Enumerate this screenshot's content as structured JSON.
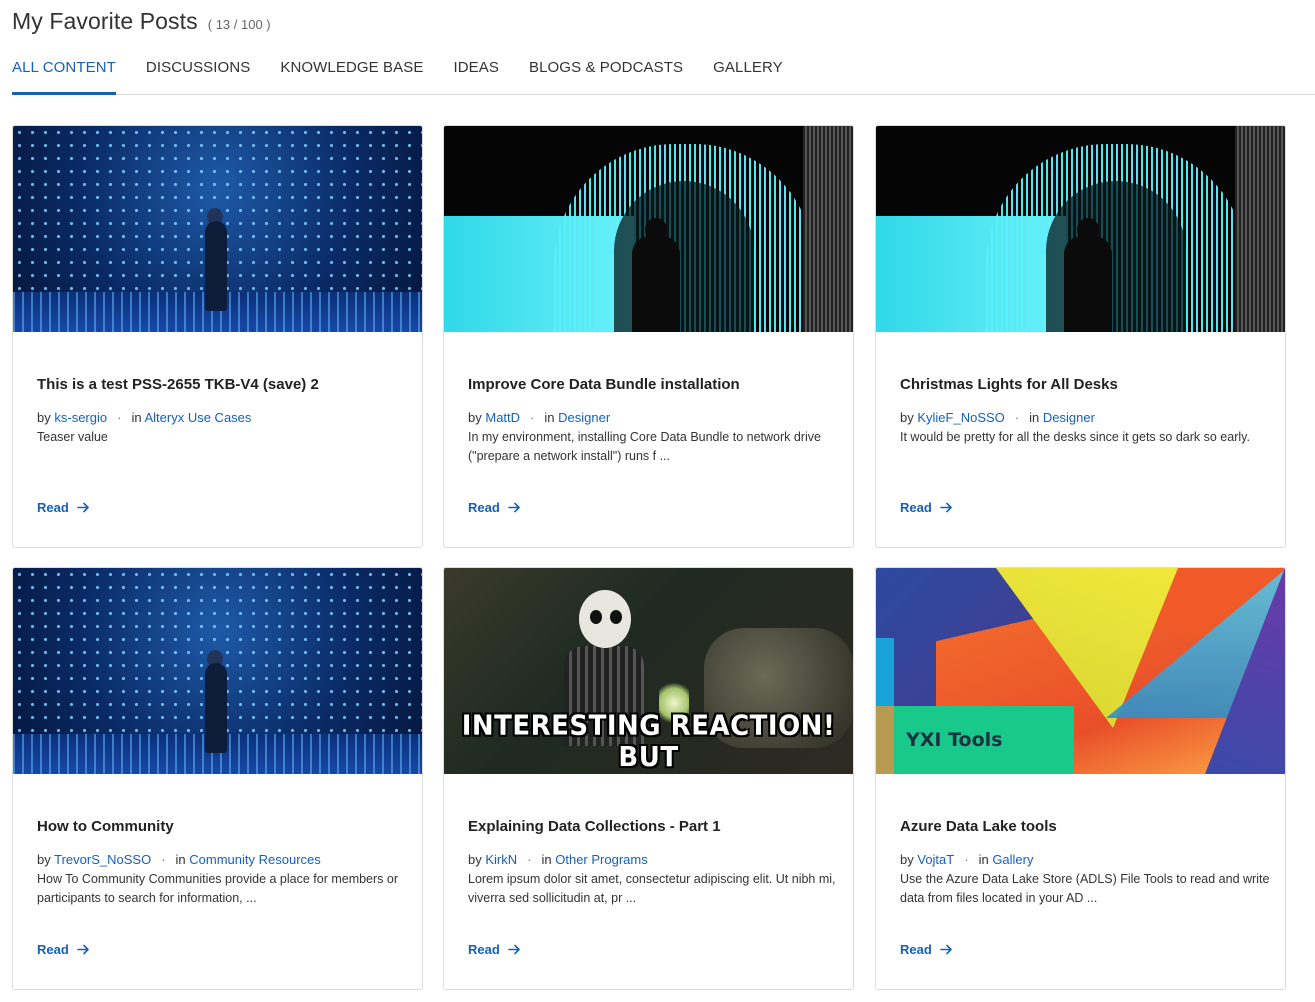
{
  "header": {
    "title": "My Favorite Posts",
    "count": "( 13 / 100 )"
  },
  "tabs": [
    {
      "label": "ALL CONTENT",
      "active": true
    },
    {
      "label": "DISCUSSIONS",
      "active": false
    },
    {
      "label": "KNOWLEDGE BASE",
      "active": false
    },
    {
      "label": "IDEAS",
      "active": false
    },
    {
      "label": "BLOGS & PODCASTS",
      "active": false
    },
    {
      "label": "GALLERY",
      "active": false
    }
  ],
  "meta_labels": {
    "by": "by",
    "in": "in",
    "separator": "·"
  },
  "cards": [
    {
      "title": "This is a test PSS-2655 TKB-V4 (save) 2",
      "author": "ks-sergio",
      "board": "Alteryx Use Cases",
      "teaser": "Teaser value",
      "read_label": "Read",
      "image": "led-dot-wall-person"
    },
    {
      "title": "Improve Core Data Bundle installation",
      "author": "MattD",
      "board": "Designer",
      "teaser": "In my environment, installing Core Data Bundle to network drive (\"prepare a network install\") runs f ...",
      "read_label": "Read",
      "image": "cyan-light-arch-person"
    },
    {
      "title": "Christmas Lights for All Desks",
      "author": "KylieF_NoSSO",
      "board": "Designer",
      "teaser": "It would be pretty for all the desks since it gets so dark so early.",
      "read_label": "Read",
      "image": "cyan-light-arch-person"
    },
    {
      "title": "How to Community",
      "author": "TrevorS_NoSSO",
      "board": "Community Resources",
      "teaser": "How To Community Communities provide a place for members or participants to search for information, ...",
      "read_label": "Read",
      "image": "led-dot-wall-person"
    },
    {
      "title": "Explaining Data Collections - Part 1",
      "author": "KirkN",
      "board": "Other Programs",
      "teaser": "Lorem ipsum dolor sit amet, consectetur adipiscing elit. Ut nibh mi, viverra sed sollicitudin at, pr ...",
      "read_label": "Read",
      "image": "movie-still",
      "image_caption": "INTERESTING REACTION! BUT"
    },
    {
      "title": "Azure Data Lake tools",
      "author": "VojtaT",
      "board": "Gallery",
      "teaser": "Use the Azure Data Lake Store (ADLS) File Tools to read and write data from files located in your AD ...",
      "read_label": "Read",
      "image": "abstract-geometric",
      "image_caption": "YXI Tools"
    }
  ],
  "colors": {
    "accent": "#1560bd",
    "text": "#222222",
    "border": "#dcdcdc"
  }
}
